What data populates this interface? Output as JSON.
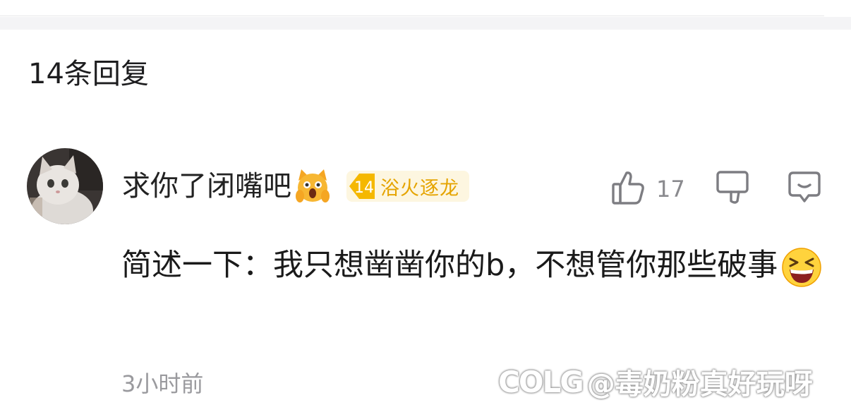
{
  "reply_header": {
    "count_label": "14条回复"
  },
  "comment": {
    "username": "求你了闭嘴吧",
    "badge": {
      "level": "14",
      "title": "浴火逐龙"
    },
    "likes": "17",
    "text": "简述一下：我只想凿凿你的b，不想管你那些破事",
    "time": "3小时前"
  },
  "icons": {
    "like": "thumbs-up-icon",
    "dislike": "thumbs-down-icon",
    "reply": "comment-bubble-icon",
    "username_emoji": "face-screaming-cat-icon",
    "text_emoji": "grinning-squinting-face-icon"
  },
  "watermark": {
    "logo": "COLG",
    "text": "@毒奶粉真好玩呀"
  },
  "colors": {
    "badge_bg": "#fdf6e0",
    "badge_accent": "#f5b800",
    "muted": "#9a9a9e"
  }
}
